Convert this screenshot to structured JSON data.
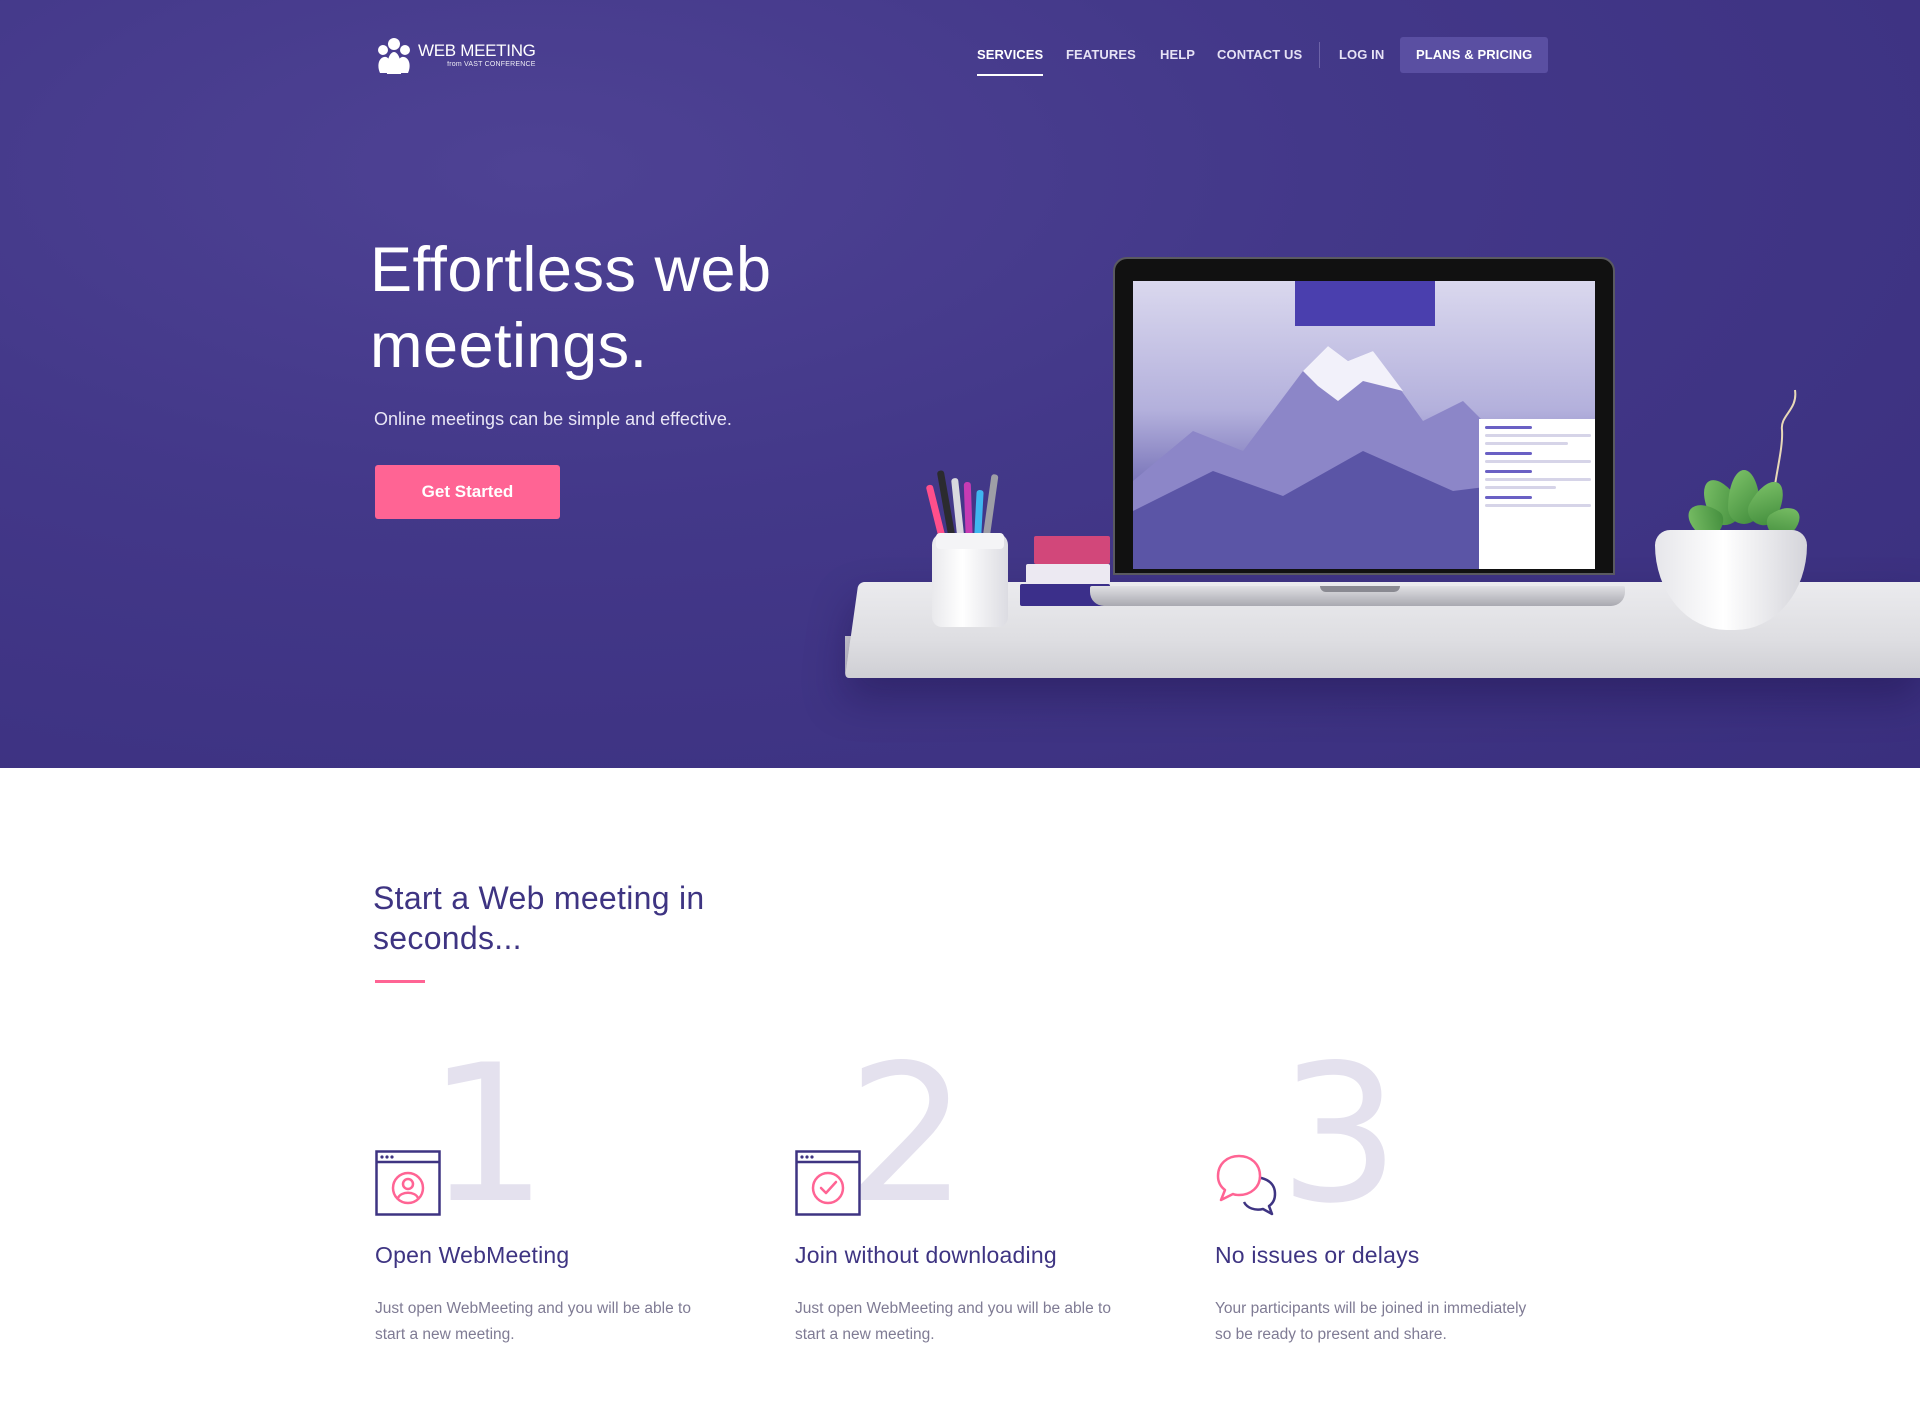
{
  "brand": {
    "name": "WEB MEETING",
    "tagline": "from VAST CONFERENCE"
  },
  "nav": {
    "items": [
      {
        "label": "SERVICES",
        "active": true
      },
      {
        "label": "FEATURES",
        "active": false
      },
      {
        "label": "HELP",
        "active": false
      },
      {
        "label": "CONTACT US",
        "active": false
      }
    ],
    "login": "LOG IN",
    "pricing": "PLANS & PRICING"
  },
  "hero": {
    "title": "Effortless web meetings.",
    "subtitle": "Online meetings can be simple and effective.",
    "cta": "Get Started"
  },
  "section": {
    "title": "Start a Web meeting in seconds..."
  },
  "steps": [
    {
      "number": "1",
      "icon": "browser-user-icon",
      "title": "Open WebMeeting",
      "description": "Just open WebMeeting and you will be able to start a new meeting."
    },
    {
      "number": "2",
      "icon": "browser-check-icon",
      "title": "Join without downloading",
      "description": "Just open WebMeeting and you will be able to start a new meeting."
    },
    {
      "number": "3",
      "icon": "chat-bubbles-icon",
      "title": "No issues or delays",
      "description": "Your participants will be joined in immediately so be ready to present and share."
    }
  ],
  "colors": {
    "hero_bg": "#433889",
    "accent": "#ff6494",
    "heading": "#3e3482",
    "body_text": "#7f7b94",
    "step_number": "#e4e1ee",
    "pricing_button": "#5a4fa2"
  }
}
